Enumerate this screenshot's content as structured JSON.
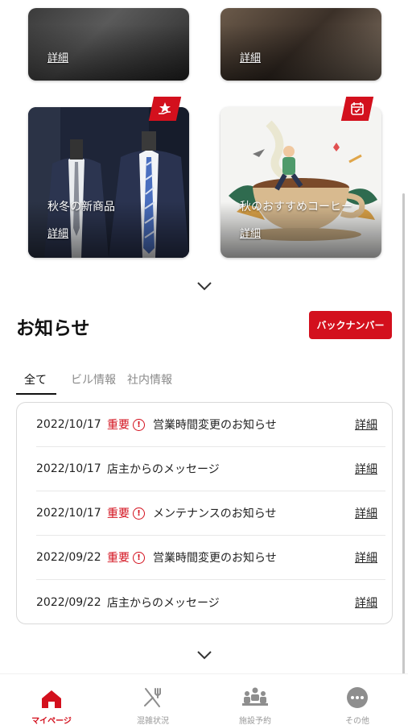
{
  "top_cards": [
    {
      "title": "",
      "detail_label": "詳細"
    },
    {
      "title": "",
      "detail_label": "詳細"
    }
  ],
  "cards": [
    {
      "title": "秋冬の新商品",
      "detail_label": "詳細",
      "badge_icon": "star-hand-icon"
    },
    {
      "title": "秋のおすすめコーヒー",
      "detail_label": "詳細",
      "badge_icon": "calendar-check-icon"
    }
  ],
  "news": {
    "title": "お知らせ",
    "back_number_label": "バックナンバー",
    "tabs": [
      "全て",
      "ビル情報",
      "社内情報"
    ],
    "active_tab": "全て",
    "items": [
      {
        "date": "2022/10/17",
        "important_label": "重要",
        "message": "営業時間変更のお知らせ",
        "detail_label": "詳細"
      },
      {
        "date": "2022/10/17",
        "important_label": "",
        "message": "店主からのメッセージ",
        "detail_label": "詳細"
      },
      {
        "date": "2022/10/17",
        "important_label": "重要",
        "message": "メンテナンスのお知らせ",
        "detail_label": "詳細"
      },
      {
        "date": "2022/09/22",
        "important_label": "重要",
        "message": "営業時間変更のお知らせ",
        "detail_label": "詳細"
      },
      {
        "date": "2022/09/22",
        "important_label": "",
        "message": "店主からのメッセージ",
        "detail_label": "詳細"
      }
    ]
  },
  "nav": {
    "items": [
      {
        "label": "マイページ",
        "icon": "home-icon",
        "active": true
      },
      {
        "label": "混雑状況",
        "icon": "fork-knife-icon",
        "active": false
      },
      {
        "label": "施設予約",
        "icon": "meeting-icon",
        "active": false
      },
      {
        "label": "その他",
        "icon": "more-icon",
        "active": false
      }
    ]
  },
  "colors": {
    "accent": "#d3101d",
    "text": "#222222",
    "muted": "#9a9a9a"
  }
}
